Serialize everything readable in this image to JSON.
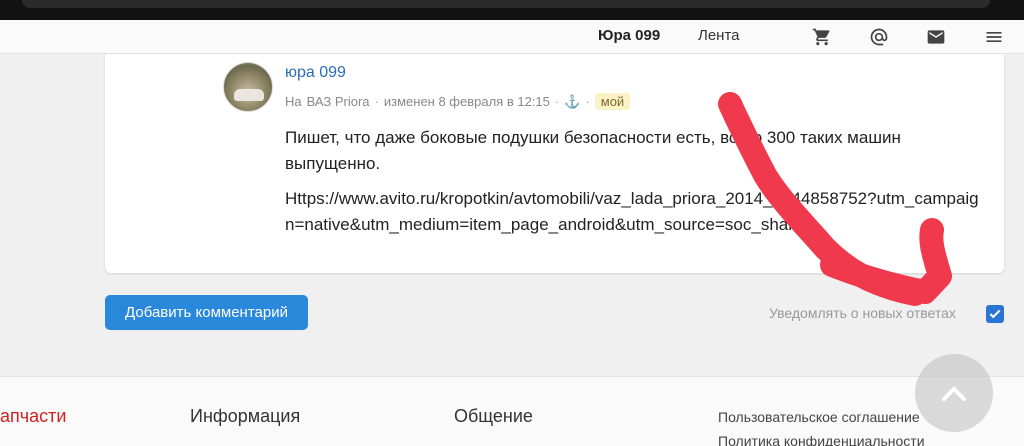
{
  "header": {
    "username": "Юра 099",
    "feed_label": "Лента",
    "icons": [
      "cart-icon",
      "at-icon",
      "mail-icon",
      "menu-icon"
    ]
  },
  "comment": {
    "author": "юра 099",
    "meta_prefix": "На",
    "board": "ВАЗ Priora",
    "edited": "изменен 8 февраля в 12:15",
    "anchor_glyph": "⚓",
    "badge": "мой",
    "text": "Пишет, что даже боковые подушки безопасности есть, всего 300 таких машин выпущенно.",
    "link": "Https://www.avito.ru/kropotkin/avtomobili/vaz_lada_priora_2014_2744858752?utm_campaign=native&utm_medium=item_page_android&utm_source=soc_sharing"
  },
  "actions": {
    "add_comment": "Добавить комментарий",
    "notify_label": "Уведомлять о новых ответах",
    "notify_checked": true
  },
  "footer": {
    "parts": "апчасти",
    "info": "Информация",
    "community": "Общение",
    "links": [
      "Пользовательское соглашение",
      "Политика конфиденциальности"
    ]
  },
  "colors": {
    "accent": "#2a88db",
    "link": "#2a6db5",
    "annotation": "#f0394d",
    "footer_red": "#d42020"
  }
}
